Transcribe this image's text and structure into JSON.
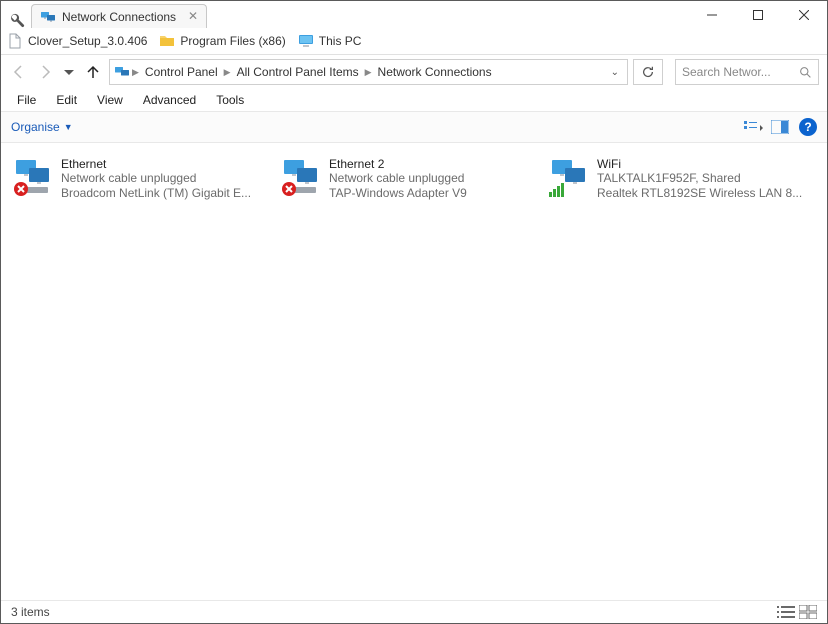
{
  "tab": {
    "title": "Network Connections"
  },
  "favorites": [
    {
      "label": "Clover_Setup_3.0.406",
      "icon": "file"
    },
    {
      "label": "Program Files (x86)",
      "icon": "folder"
    },
    {
      "label": "This PC",
      "icon": "thispc"
    }
  ],
  "breadcrumb": {
    "items": [
      "Control Panel",
      "All Control Panel Items",
      "Network Connections"
    ]
  },
  "search": {
    "placeholder": "Search Networ..."
  },
  "menu": {
    "file": "File",
    "edit": "Edit",
    "view": "View",
    "advanced": "Advanced",
    "tools": "Tools"
  },
  "toolbar": {
    "organise": "Organise"
  },
  "connections": [
    {
      "name": "Ethernet",
      "status": "Network cable unplugged",
      "device": "Broadcom NetLink (TM) Gigabit E...",
      "state": "error"
    },
    {
      "name": "Ethernet 2",
      "status": "Network cable unplugged",
      "device": "TAP-Windows Adapter V9",
      "state": "error"
    },
    {
      "name": "WiFi",
      "status": "TALKTALK1F952F, Shared",
      "device": "Realtek RTL8192SE Wireless LAN 8...",
      "state": "connected"
    }
  ],
  "statusbar": {
    "text": "3 items"
  }
}
